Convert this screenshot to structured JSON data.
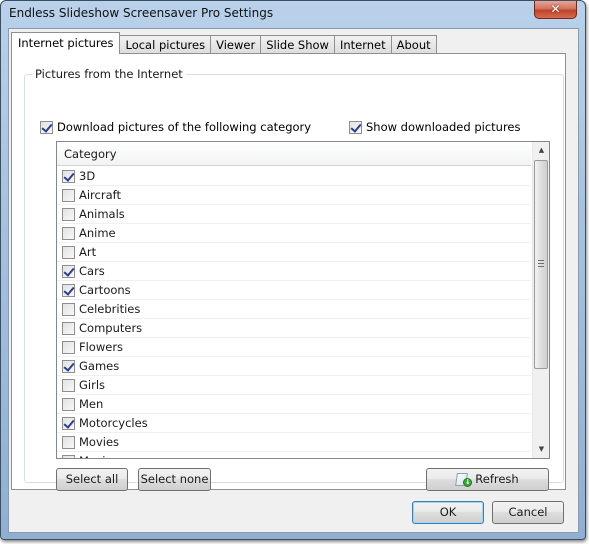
{
  "window": {
    "title": "Endless Slideshow Screensaver Pro Settings",
    "close_glyph": "✕"
  },
  "tabs": [
    {
      "label": "Internet pictures",
      "active": true
    },
    {
      "label": "Local pictures",
      "active": false
    },
    {
      "label": "Viewer",
      "active": false
    },
    {
      "label": "Slide Show",
      "active": false
    },
    {
      "label": "Internet",
      "active": false
    },
    {
      "label": "About",
      "active": false
    }
  ],
  "group": {
    "label": "Pictures from the Internet",
    "download_checkbox": {
      "label": "Download pictures of the following category",
      "checked": true
    },
    "show_checkbox": {
      "label": "Show downloaded pictures",
      "checked": true
    }
  },
  "category_list": {
    "header": "Category",
    "items": [
      {
        "label": "3D",
        "checked": true
      },
      {
        "label": "Aircraft",
        "checked": false
      },
      {
        "label": "Animals",
        "checked": false
      },
      {
        "label": "Anime",
        "checked": false
      },
      {
        "label": "Art",
        "checked": false
      },
      {
        "label": "Cars",
        "checked": true
      },
      {
        "label": "Cartoons",
        "checked": true
      },
      {
        "label": "Celebrities",
        "checked": false
      },
      {
        "label": "Computers",
        "checked": false
      },
      {
        "label": "Flowers",
        "checked": false
      },
      {
        "label": "Games",
        "checked": true
      },
      {
        "label": "Girls",
        "checked": false
      },
      {
        "label": "Men",
        "checked": false
      },
      {
        "label": "Motorcycles",
        "checked": true
      },
      {
        "label": "Movies",
        "checked": false
      },
      {
        "label": "Music",
        "checked": false
      }
    ],
    "scroll_up_glyph": "▲",
    "scroll_down_glyph": "▼"
  },
  "buttons": {
    "select_all": "Select all",
    "select_none": "Select none",
    "refresh": "Refresh",
    "ok": "OK",
    "cancel": "Cancel"
  },
  "icons": {
    "refresh": "refresh-download-icon"
  }
}
